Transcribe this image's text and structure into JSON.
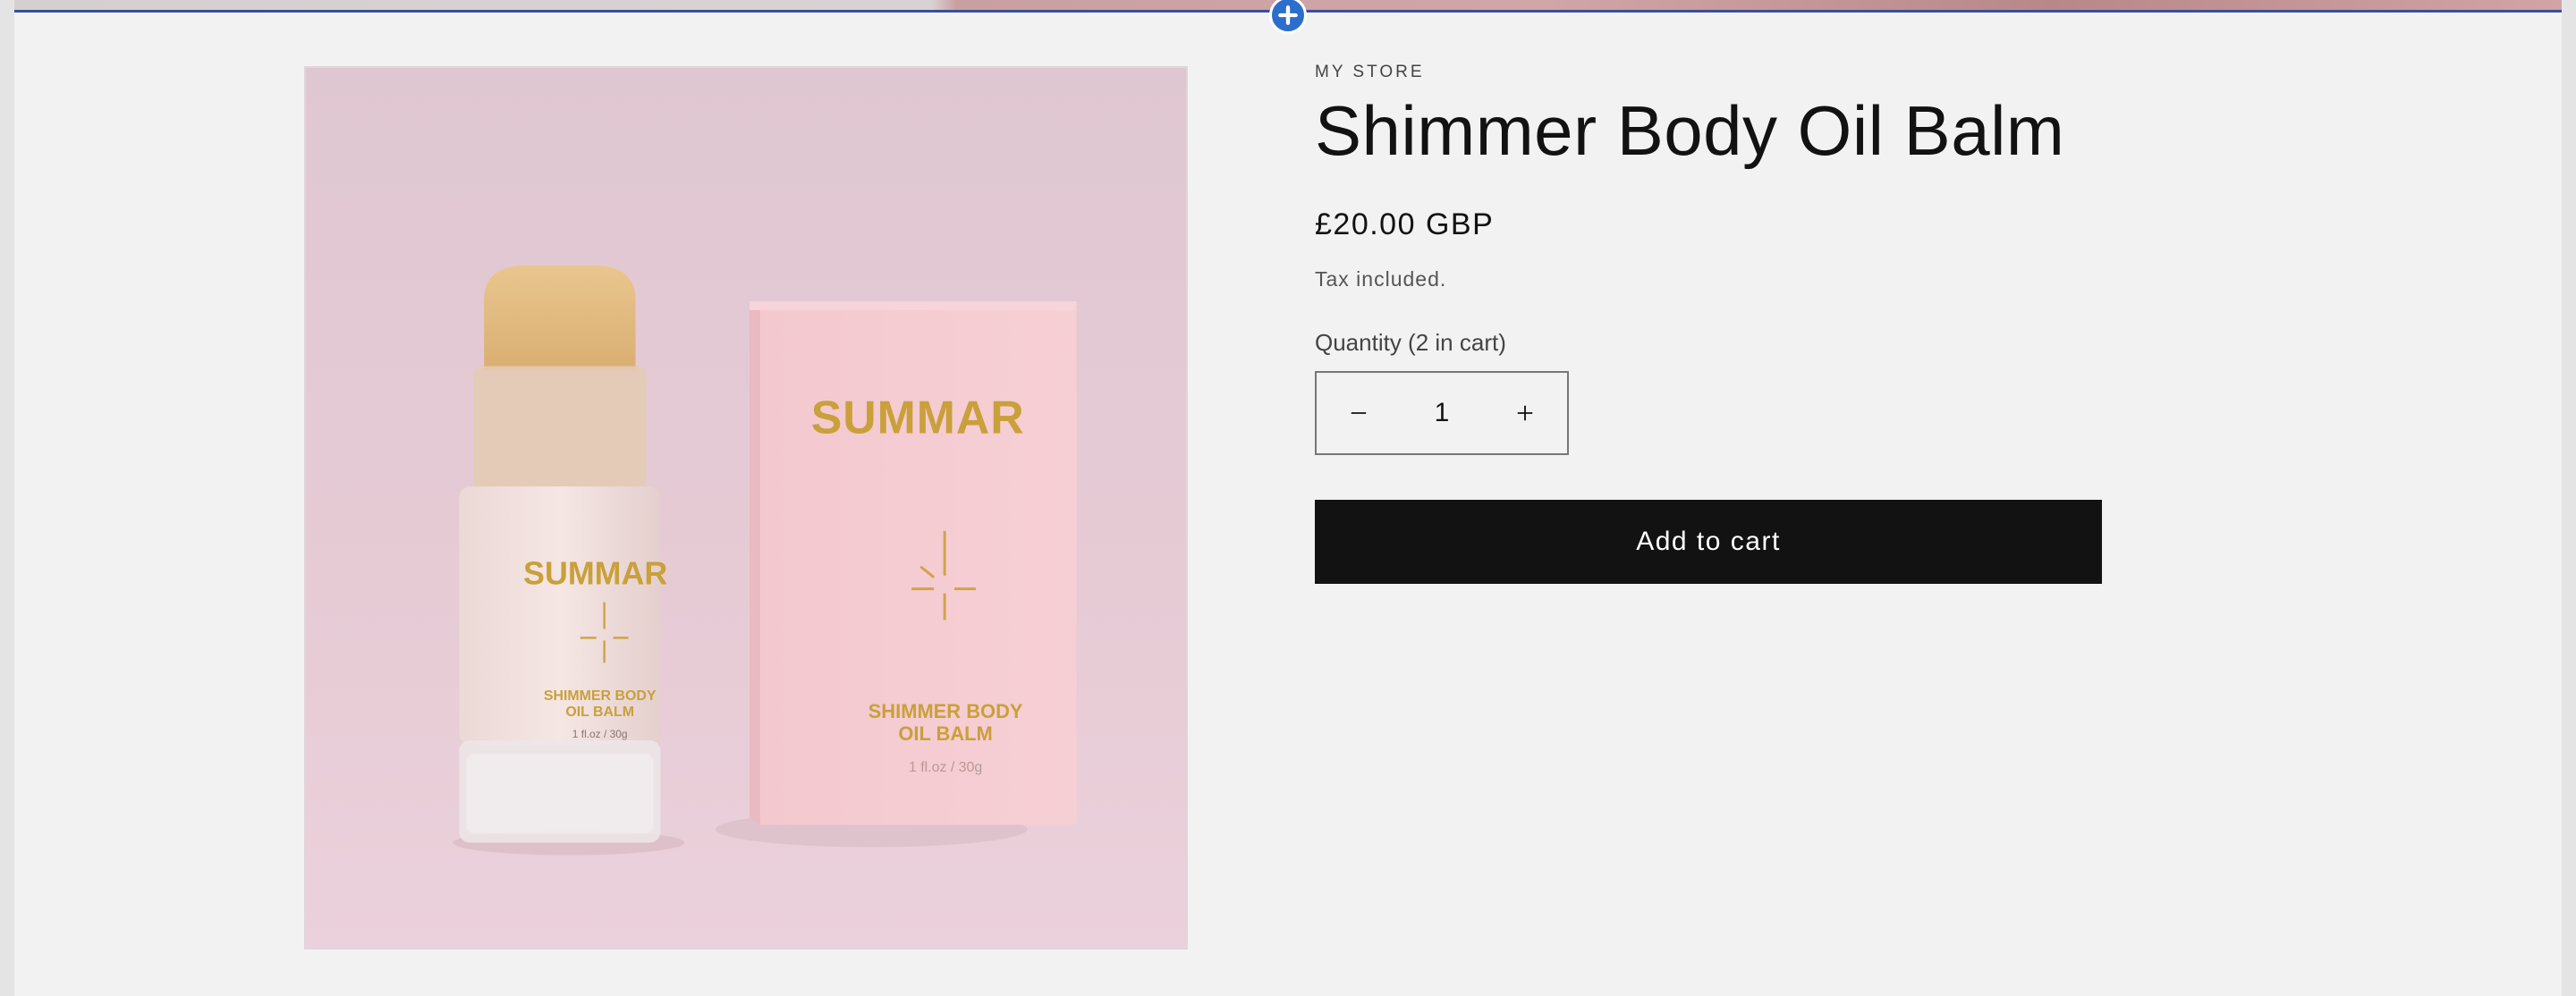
{
  "editor": {
    "add_section_icon": "plus-icon"
  },
  "product": {
    "vendor": "MY STORE",
    "title": "Shimmer Body Oil Balm",
    "price": "£20.00 GBP",
    "tax_note": "Tax included.",
    "quantity_label": "Quantity (2 in cart)",
    "quantity_value": "1",
    "add_to_cart_label": "Add to cart",
    "image": {
      "brand": "SUMMAR",
      "product_line_1": "SHIMMER BODY",
      "product_line_2": "OIL BALM",
      "size": "1 fl.oz / 30g"
    }
  },
  "colors": {
    "button_bg": "#121212",
    "accent_blue": "#2c6ecb",
    "background": "#f2f2f2"
  }
}
